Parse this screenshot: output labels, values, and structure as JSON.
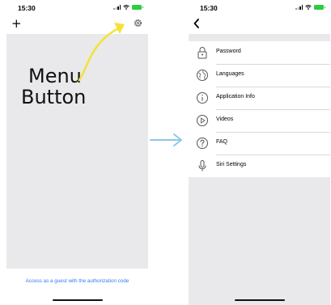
{
  "left_screen": {
    "status_time": "15:30",
    "guest_link": "Access as a guest with the authorization code"
  },
  "right_screen": {
    "status_time": "15:30",
    "settings_items": [
      {
        "label": "Password",
        "icon": "lock-icon"
      },
      {
        "label": "Languages",
        "icon": "globe-icon"
      },
      {
        "label": "Application Info",
        "icon": "info-icon"
      },
      {
        "label": "Videos",
        "icon": "play-icon"
      },
      {
        "label": "FAQ",
        "icon": "question-icon"
      },
      {
        "label": "Siri Settings",
        "icon": "microphone-icon"
      }
    ]
  },
  "annotation": {
    "line1": "Menu",
    "line2": "Button"
  },
  "colors": {
    "link": "#3478f6",
    "annotation_arrow": "#f4e23a",
    "flow_arrow": "#8cc8ea",
    "battery": "#2ecc40",
    "background_gray": "#e9e9ec"
  }
}
